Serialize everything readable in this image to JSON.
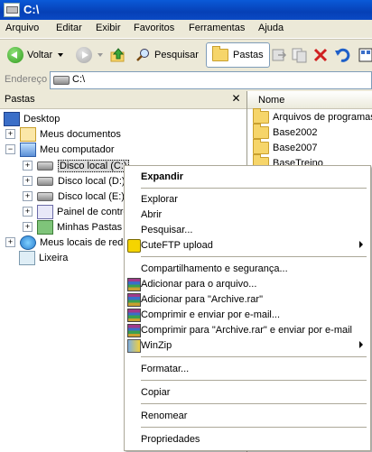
{
  "window": {
    "title": "C:\\"
  },
  "menu": [
    "Arquivo",
    "Editar",
    "Exibir",
    "Favoritos",
    "Ferramentas",
    "Ajuda"
  ],
  "toolbar": {
    "back_label": "Voltar",
    "search_label": "Pesquisar",
    "folders_label": "Pastas"
  },
  "address": {
    "label": "Endereço",
    "value": "C:\\"
  },
  "left_pane": {
    "title": "Pastas",
    "tree": [
      "Desktop",
      "Meus documentos",
      "Meu computador",
      "Disco local (C:)",
      "Disco local (D:)",
      "Disco local (E:)",
      "Painel de contro",
      "Minhas Pastas c",
      "Meus locais de rede",
      "Lixeira"
    ]
  },
  "right_pane": {
    "column": "Nome",
    "files": [
      "Arquivos de programas",
      "Base2002",
      "Base2007",
      "BaseTreino"
    ]
  },
  "context_menu": {
    "items": [
      "Expandir",
      "Explorar",
      "Abrir",
      "Pesquisar...",
      "CuteFTP upload",
      "Compartilhamento e segurança...",
      "Adicionar para o arquivo...",
      "Adicionar para \"Archive.rar\"",
      "Comprimir e enviar por e-mail...",
      "Comprimir para \"Archive.rar\" e enviar por e-mail",
      "WinZip",
      "Formatar...",
      "Copiar",
      "Renomear",
      "Propriedades"
    ]
  }
}
